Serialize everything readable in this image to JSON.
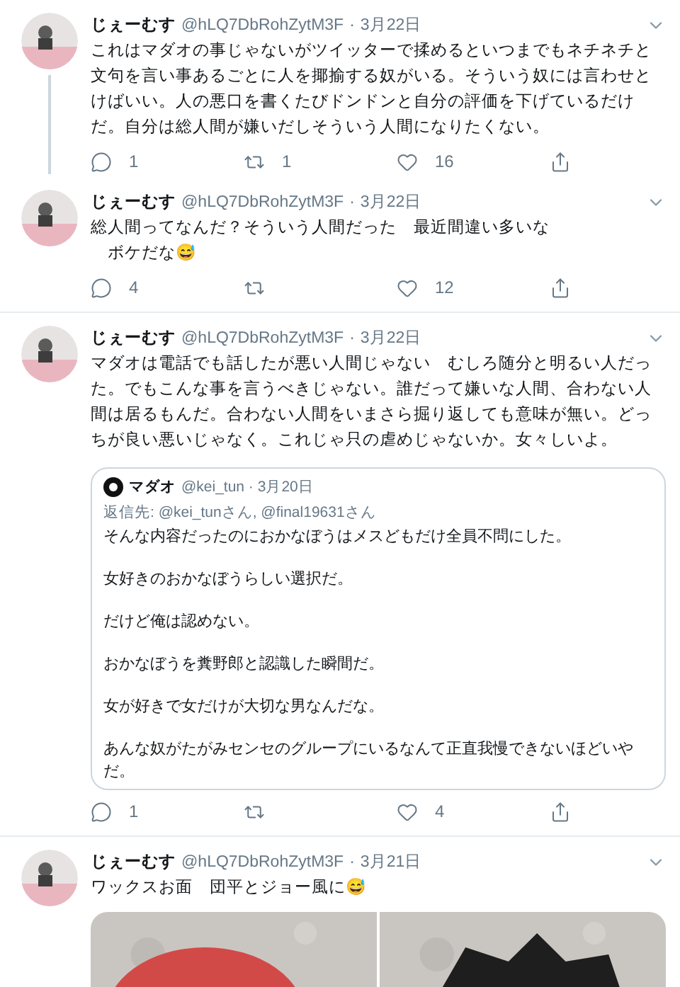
{
  "tweets": [
    {
      "name": "じぇーむす",
      "handle": "@hLQ7DbRohZytM3F",
      "separator": "·",
      "date": "3月22日",
      "thread": true,
      "lines": [
        "これはマダオの事じゃないがツイッターで揉めるといつまでもネチネチと文句を言い事あるごとに人を揶揄する奴がいる。そういう奴には言わせとけばいい。人の悪口を書くたびドンドンと自分の評価を下げているだけだ。自分は総人間が嫌いだしそういう人間になりたくない。"
      ],
      "replies": "1",
      "retweets": "1",
      "likes": "16"
    },
    {
      "name": "じぇーむす",
      "handle": "@hLQ7DbRohZytM3F",
      "separator": "·",
      "date": "3月22日",
      "thread": false,
      "lines": [
        "総人間ってなんだ？そういう人間だった　最近間違い多いな",
        "　ボケだな😅"
      ],
      "replies": "4",
      "likes": "12"
    },
    {
      "name": "じぇーむす",
      "handle": "@hLQ7DbRohZytM3F",
      "separator": "·",
      "date": "3月22日",
      "thread": false,
      "lines": [
        "マダオは電話でも話したが悪い人間じゃない　むしろ随分と明るい人だった。でもこんな事を言うべきじゃない。誰だって嫌いな人間、合わない人間は居るもんだ。合わない人間をいまさら掘り返しても意味が無い。どっちが良い悪いじゃなく。これじゃ只の虐めじゃないか。女々しいよ。"
      ],
      "quote": {
        "name": "マダオ",
        "handle": "@kei_tun · 3月20日",
        "reply_to": "返信先: @kei_tunさん, @final19631さん",
        "paragraphs": [
          "そんな内容だったのにおかなぼうはメスどもだけ全員不問にした。",
          "女好きのおかなぼうらしい選択だ。",
          "だけど俺は認めない。",
          "おかなぼうを糞野郎と認識した瞬間だ。",
          "女が好きで女だけが大切な男なんだな。",
          "あんな奴がたがみセンセのグループにいるなんて正直我慢できないほどいやだ。"
        ]
      },
      "replies": "1",
      "likes": "4"
    },
    {
      "name": "じぇーむす",
      "handle": "@hLQ7DbRohZytM3F",
      "separator": "·",
      "date": "3月21日",
      "thread": false,
      "lines": [
        "ワックスお面　団平とジョー風に😅"
      ],
      "media": [
        {
          "kind": "picture"
        },
        {
          "kind": "picture"
        }
      ]
    }
  ]
}
